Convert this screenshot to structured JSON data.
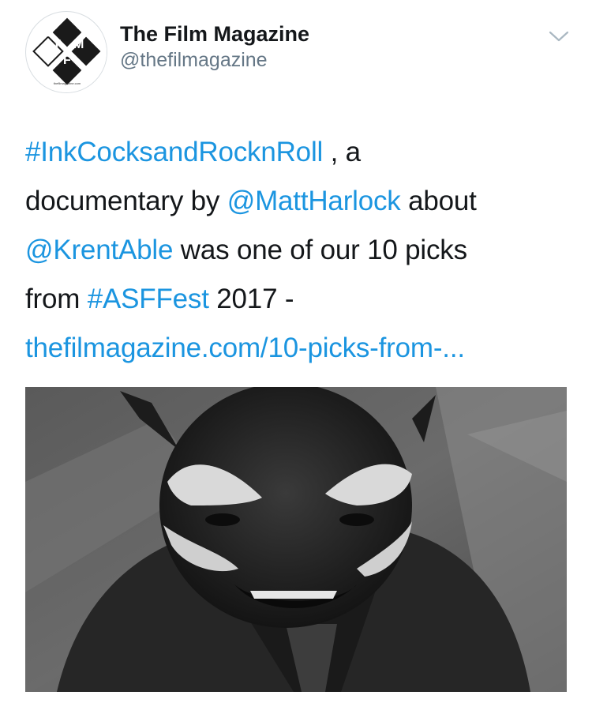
{
  "author": {
    "display_name": "The Film Magazine",
    "handle": "@thefilmagazine",
    "avatar_letters": [
      "T",
      "M",
      "F"
    ],
    "avatar_caption": "thefilmagazine.com"
  },
  "tweet": {
    "hashtag_1": "#InkCocksandRocknRoll",
    "text_1": " , a",
    "text_2": "documentary by ",
    "mention_1": "@MattHarlock",
    "text_3": " about",
    "mention_2": "@KrentAble",
    "text_4": " was one of our 10 picks",
    "text_5": "from ",
    "hashtag_2": "#ASFFest",
    "text_6": " 2017 -",
    "link": "thefilmagazine.com/10-picks-from-..."
  },
  "icons": {
    "menu": "chevron-down-icon"
  },
  "colors": {
    "link": "#1b95e0",
    "handle": "#657786",
    "text": "#14171a"
  }
}
